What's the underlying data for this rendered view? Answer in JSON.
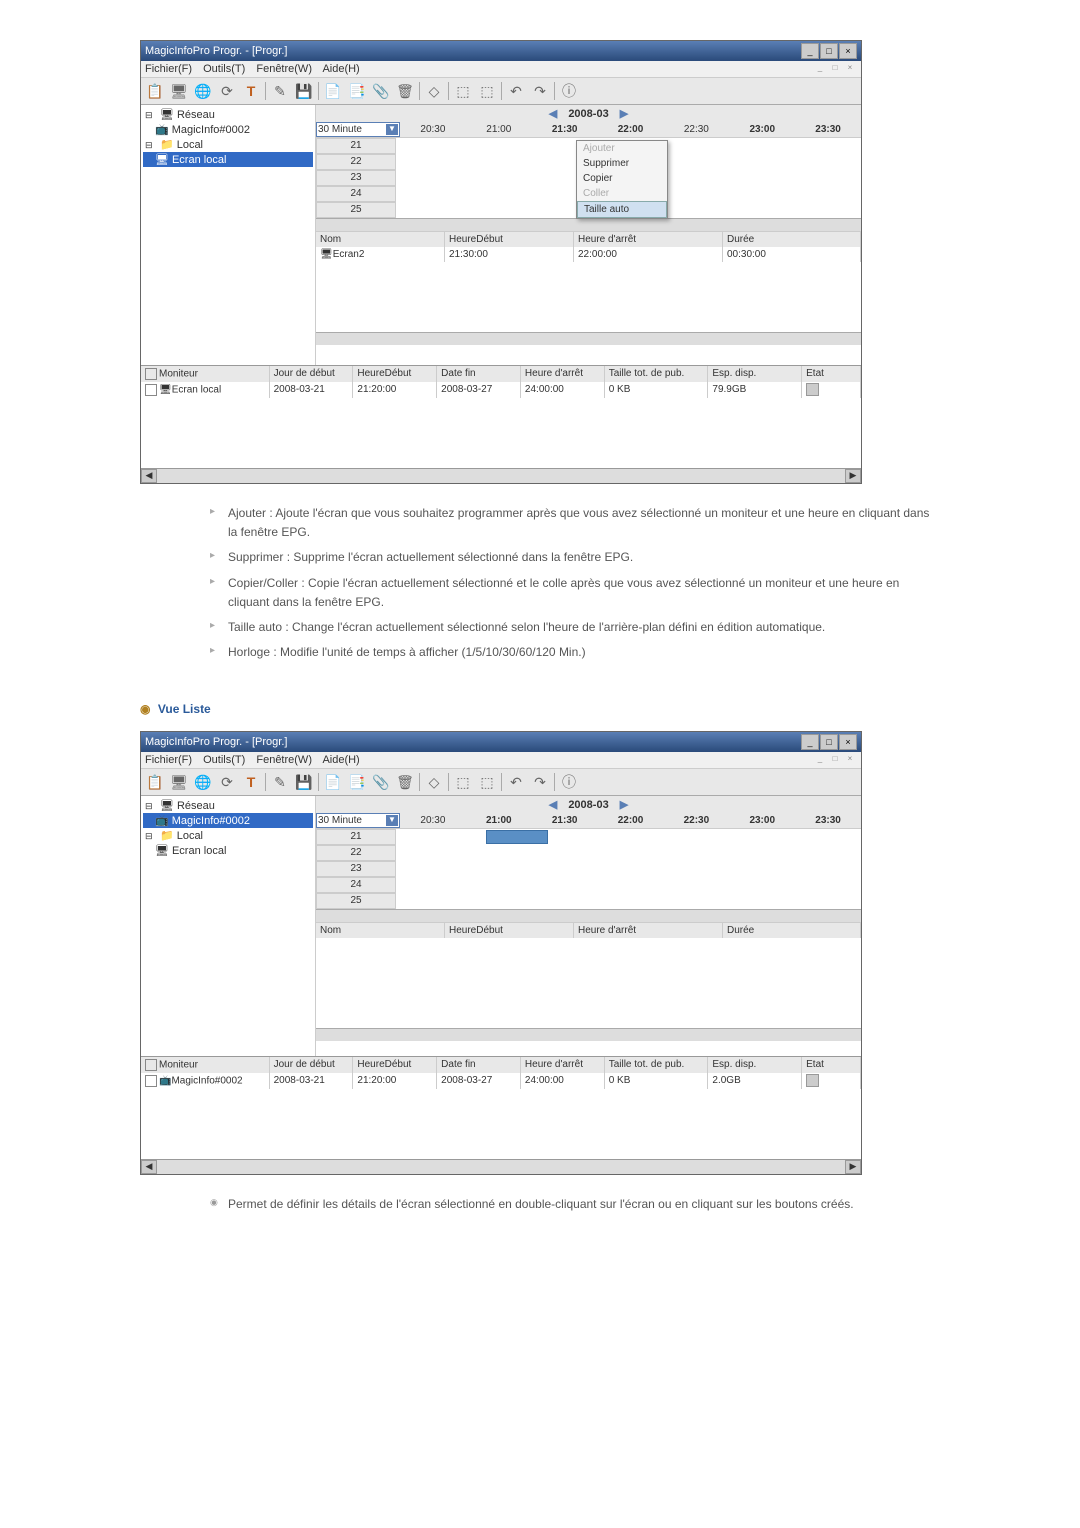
{
  "screenshot1": {
    "titlebar": "MagicInfoPro Progr. - [Progr.]",
    "menubar": {
      "file": "Fichier(F)",
      "tools": "Outils(T)",
      "window": "Fenêtre(W)",
      "help": "Aide(H)"
    },
    "tree": {
      "reseau": "Réseau",
      "magicinfo": "MagicInfo#0002",
      "local": "Local",
      "ecran_local": "Ecran local"
    },
    "date_nav": "2008-03",
    "interval": "30 Minute",
    "time_cols": [
      "20:30",
      "21:00",
      "21:30",
      "22:00",
      "22:30",
      "23:00",
      "23:30"
    ],
    "rows": [
      "21",
      "22",
      "23",
      "24",
      "25"
    ],
    "context": {
      "add": "Ajouter",
      "del": "Supprimer",
      "copy": "Copier",
      "paste": "Coller",
      "auto": "Taille auto"
    },
    "sched_header": {
      "nom": "Nom",
      "hd": "HeureDébut",
      "ha": "Heure d'arrêt",
      "du": "Durée"
    },
    "sched_row": {
      "nom": "Ecran2",
      "hd": "21:30:00",
      "ha": "22:00:00",
      "du": "00:30:00"
    },
    "bottom_header": {
      "mon": "Moniteur",
      "jd": "Jour de début",
      "hd": "HeureDébut",
      "df": "Date fin",
      "ha": "Heure d'arrêt",
      "tt": "Taille tot. de pub.",
      "ed": "Esp. disp.",
      "et": "Etat"
    },
    "bottom_row": {
      "mon": "Ecran local",
      "jd": "2008-03-21",
      "hd": "21:20:00",
      "df": "2008-03-27",
      "ha": "24:00:00",
      "tt": "0 KB",
      "ed": "79.9GB",
      "et": ""
    }
  },
  "bullets1": {
    "b1": "Ajouter : Ajoute l'écran que vous souhaitez programmer après que vous avez sélectionné un moniteur et une heure en cliquant dans la fenêtre EPG.",
    "b2": "Supprimer : Supprime l'écran actuellement sélectionné dans la fenêtre EPG.",
    "b3": "Copier/Coller : Copie l'écran actuellement sélectionné et le colle après que vous avez sélectionné un moniteur et une heure en cliquant dans la fenêtre EPG.",
    "b4": "Taille auto : Change l'écran actuellement sélectionné selon l'heure de l'arrière-plan défini en édition automatique.",
    "b5": "Horloge : Modifie l'unité de temps à afficher (1/5/10/30/60/120 Min.)"
  },
  "section_title": "Vue Liste",
  "screenshot2": {
    "titlebar": "MagicInfoPro Progr. - [Progr.]",
    "menubar": {
      "file": "Fichier(F)",
      "tools": "Outils(T)",
      "window": "Fenêtre(W)",
      "help": "Aide(H)"
    },
    "tree": {
      "reseau": "Réseau",
      "magicinfo": "MagicInfo#0002",
      "local": "Local",
      "ecran_local": "Ecran local"
    },
    "date_nav": "2008-03",
    "interval": "30 Minute",
    "time_cols": [
      "20:30",
      "21:00",
      "21:30",
      "22:00",
      "22:30",
      "23:00",
      "23:30"
    ],
    "rows": [
      "21",
      "22",
      "23",
      "24",
      "25"
    ],
    "sched_header": {
      "nom": "Nom",
      "hd": "HeureDébut",
      "ha": "Heure d'arrêt",
      "du": "Durée"
    },
    "bottom_header": {
      "mon": "Moniteur",
      "jd": "Jour de début",
      "hd": "HeureDébut",
      "df": "Date fin",
      "ha": "Heure d'arrêt",
      "tt": "Taille tot. de pub.",
      "ed": "Esp. disp.",
      "et": "Etat"
    },
    "bottom_row": {
      "mon": "MagicInfo#0002",
      "jd": "2008-03-21",
      "hd": "21:20:00",
      "df": "2008-03-27",
      "ha": "24:00:00",
      "tt": "0 KB",
      "ed": "2.0GB",
      "et": ""
    }
  },
  "bullets2": {
    "b1": "Permet de définir les détails de l'écran sélectionné en double-cliquant sur l'écran ou en cliquant sur les boutons créés."
  }
}
